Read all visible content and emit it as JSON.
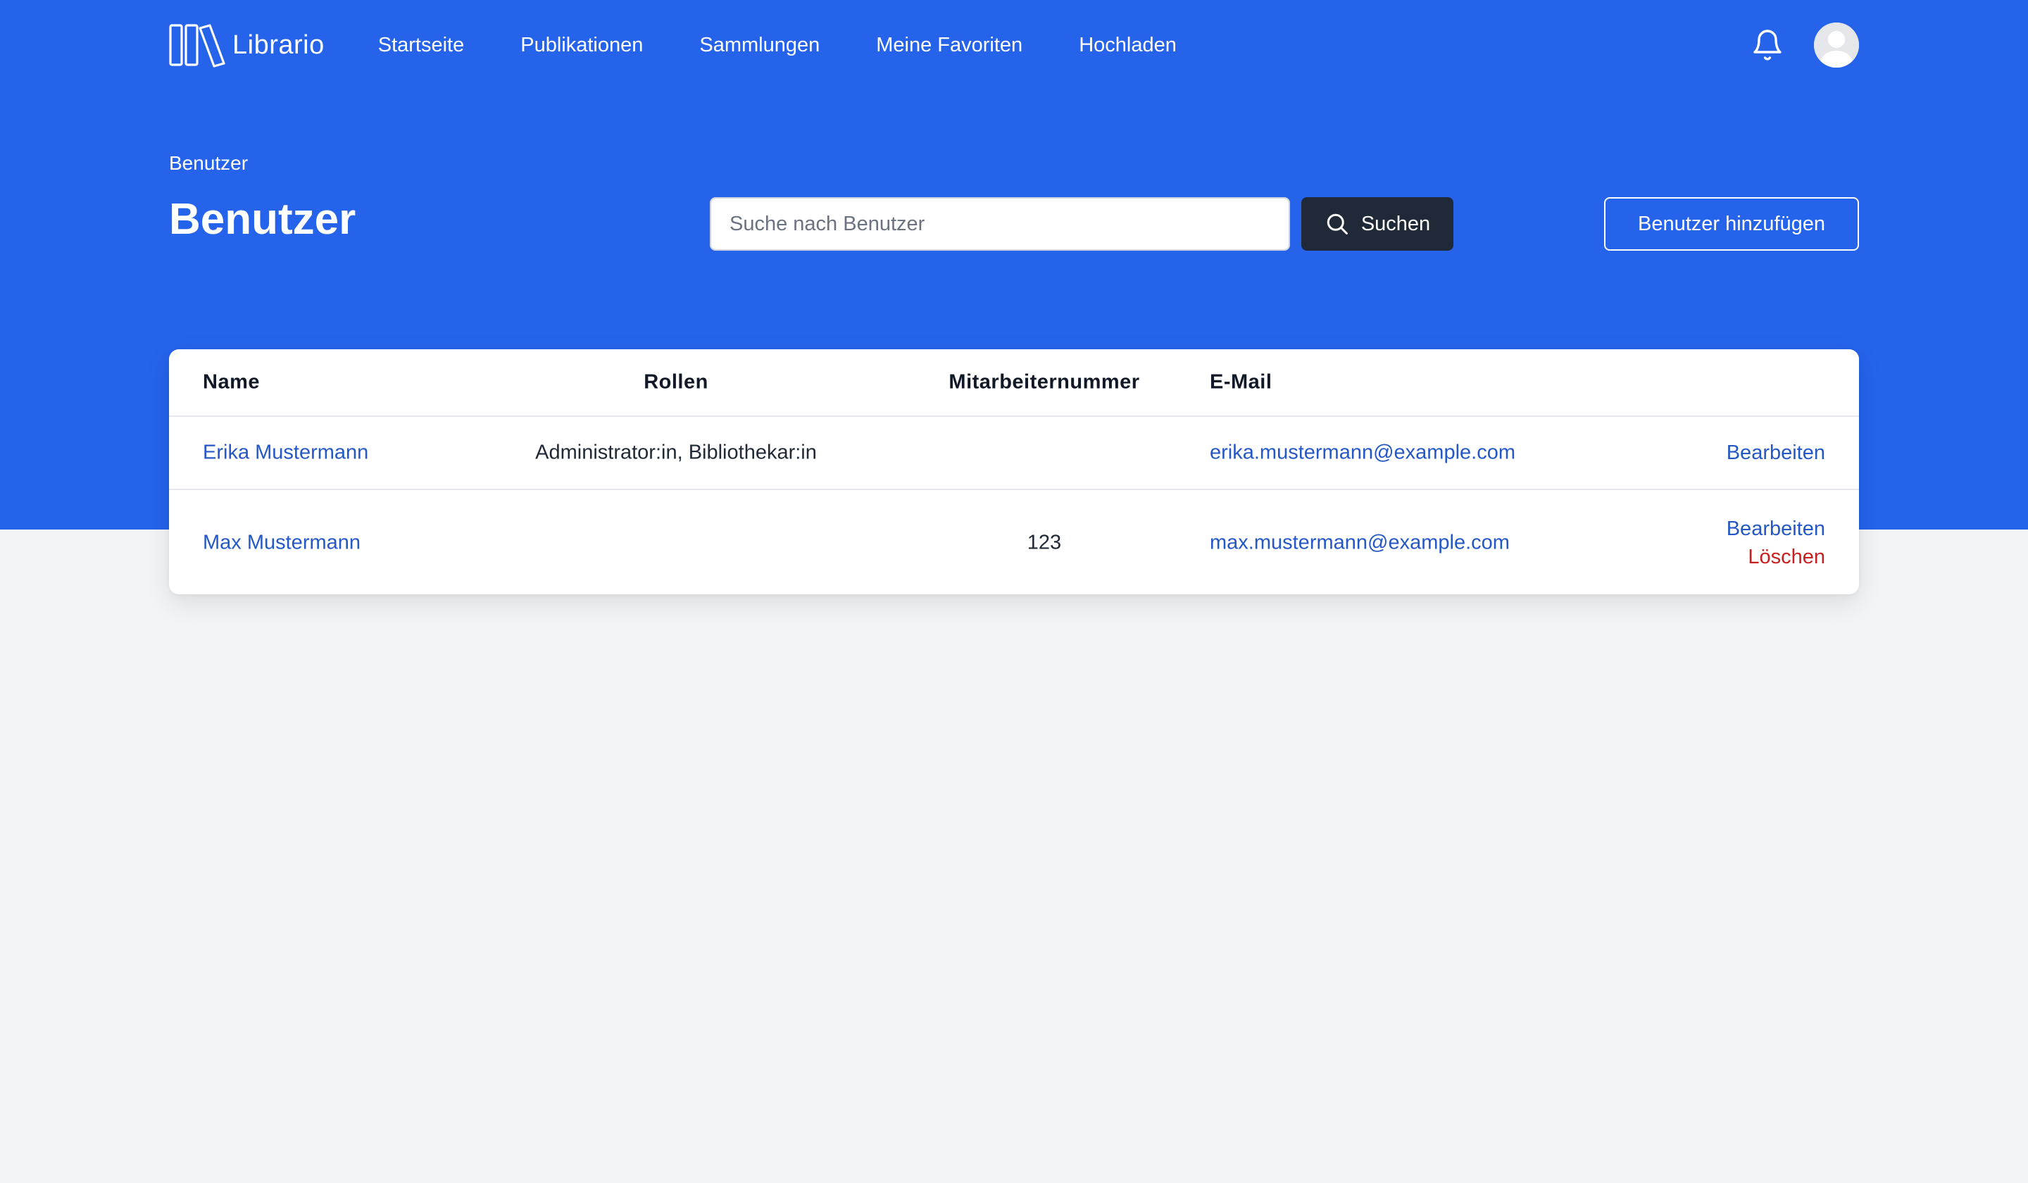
{
  "app": {
    "name": "Librario"
  },
  "nav": {
    "links": [
      "Startseite",
      "Publikationen",
      "Sammlungen",
      "Meine Favoriten",
      "Hochladen"
    ],
    "bell_icon": "bell-icon",
    "avatar_icon": "user-avatar-icon"
  },
  "header": {
    "breadcrumb": "Benutzer",
    "title": "Benutzer",
    "search_placeholder": "Suche nach Benutzer",
    "search_value": "",
    "search_button": "Suchen",
    "add_button": "Benutzer hinzufügen"
  },
  "table": {
    "columns": [
      "Name",
      "Rollen",
      "Mitarbeiternummer",
      "E-Mail"
    ],
    "rows": [
      {
        "name": "Erika Mustermann",
        "roles": "Administrator:in, Bibliothekar:in",
        "employee_number": "",
        "email": "erika.mustermann@example.com",
        "actions": [
          "Bearbeiten"
        ]
      },
      {
        "name": "Max Mustermann",
        "roles": "",
        "employee_number": "123",
        "email": "max.mustermann@example.com",
        "actions": [
          "Bearbeiten",
          "Löschen"
        ]
      }
    ]
  },
  "colors": {
    "primary": "#2563eb",
    "dark_button": "#1f2937",
    "link": "#2458c6",
    "danger": "#c81e1e",
    "background": "#f3f4f6"
  }
}
